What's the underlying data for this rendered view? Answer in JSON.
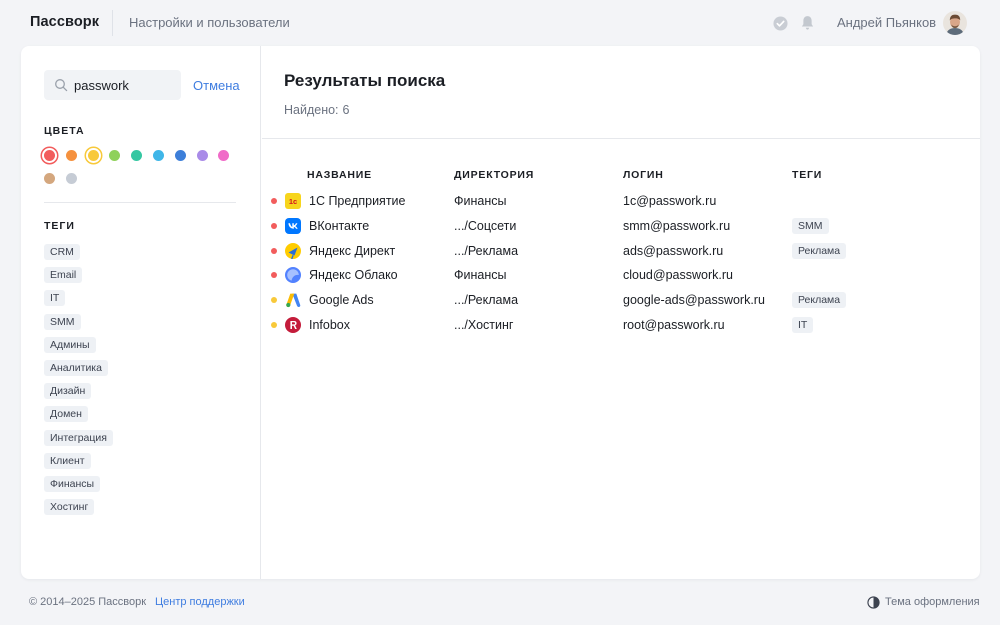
{
  "header": {
    "brand": "Пассворк",
    "nav_link": "Настройки и пользователи",
    "user_name": "Андрей Пьянков"
  },
  "sidebar": {
    "search": {
      "value": "passwork",
      "placeholder": ""
    },
    "cancel_label": "Отмена",
    "colors_title": "ЦВЕТА",
    "colors": [
      {
        "name": "red",
        "hex": "#f25c5c",
        "selected": true
      },
      {
        "name": "orange",
        "hex": "#f5913e",
        "selected": false
      },
      {
        "name": "yellow",
        "hex": "#f8c93a",
        "selected": true
      },
      {
        "name": "light-green",
        "hex": "#8fd15a",
        "selected": false
      },
      {
        "name": "teal",
        "hex": "#35c7a2",
        "selected": false
      },
      {
        "name": "sky",
        "hex": "#3fb6e8",
        "selected": false
      },
      {
        "name": "blue",
        "hex": "#3d7fd9",
        "selected": false
      },
      {
        "name": "violet",
        "hex": "#a98be8",
        "selected": false
      },
      {
        "name": "pink",
        "hex": "#f06bc8",
        "selected": false
      },
      {
        "name": "brown",
        "hex": "#d4a77e",
        "selected": false
      },
      {
        "name": "gray",
        "hex": "#c6ccd5",
        "selected": false
      }
    ],
    "tags_title": "ТЕГИ",
    "tags": [
      "CRM",
      "Email",
      "IT",
      "SMM",
      "Админы",
      "Аналитика",
      "Дизайн",
      "Домен",
      "Интеграция",
      "Клиент",
      "Финансы",
      "Хостинг"
    ]
  },
  "main": {
    "title": "Результаты поиска",
    "found_label": "Найдено:",
    "found_count": "6",
    "columns": {
      "name": "НАЗВАНИЕ",
      "directory": "ДИРЕКТОРИЯ",
      "login": "ЛОГИН",
      "tags": "ТЕГИ"
    },
    "rows": [
      {
        "name": "1С Предприятие",
        "directory": "Финансы",
        "login": "1c@passwork.ru",
        "tag": "",
        "dot_color": "#f25c5c",
        "icon": "1c-icon"
      },
      {
        "name": "ВКонтакте",
        "directory": ".../Соцсети",
        "login": "smm@passwork.ru",
        "tag": "SMM",
        "dot_color": "#f25c5c",
        "icon": "vk-icon"
      },
      {
        "name": "Яндекс Директ",
        "directory": ".../Реклама",
        "login": "ads@passwork.ru",
        "tag": "Реклама",
        "dot_color": "#f25c5c",
        "icon": "yandex-direct-icon"
      },
      {
        "name": "Яндекс Облако",
        "directory": "Финансы",
        "login": "cloud@passwork.ru",
        "tag": "",
        "dot_color": "#f25c5c",
        "icon": "yandex-cloud-icon"
      },
      {
        "name": "Google Ads",
        "directory": ".../Реклама",
        "login": "google-ads@passwork.ru",
        "tag": "Реклама",
        "dot_color": "#f8c93a",
        "icon": "google-ads-icon"
      },
      {
        "name": "Infobox",
        "directory": ".../Хостинг",
        "login": "root@passwork.ru",
        "tag": "IT",
        "dot_color": "#f8c93a",
        "icon": "infobox-icon"
      }
    ]
  },
  "footer": {
    "copyright": "© 2014–2025 Пассворк",
    "support_link": "Центр поддержки",
    "theme_label": "Тема оформления"
  }
}
